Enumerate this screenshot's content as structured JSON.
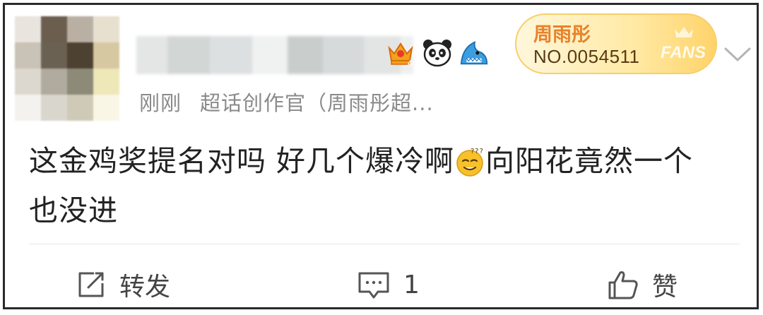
{
  "post": {
    "time": "刚刚",
    "source": "超话创作官（周雨彤超...",
    "text_line1_a": "这金鸡奖提名对吗 好几个爆冷啊",
    "text_line1_b": "向阳花竟然一个",
    "text_line2": "也没进"
  },
  "fans_badge": {
    "name": "周雨彤",
    "number": "NO.0054511",
    "label": "FANS"
  },
  "actions": {
    "repost_label": "转发",
    "comment_count": "1",
    "like_label": "赞"
  },
  "icons": {
    "user_badges": [
      "crown-level-4-icon",
      "panda-icon",
      "shark-icon"
    ],
    "emoji": "dizzy-face-emoji-icon",
    "chevron": "chevron-down-icon",
    "repost": "repost-icon",
    "comment": "comment-icon",
    "like": "thumbs-up-icon"
  },
  "colors": {
    "fans_name": "#e8822a",
    "meta_text": "#8a8a8a",
    "body_text": "#222222"
  }
}
